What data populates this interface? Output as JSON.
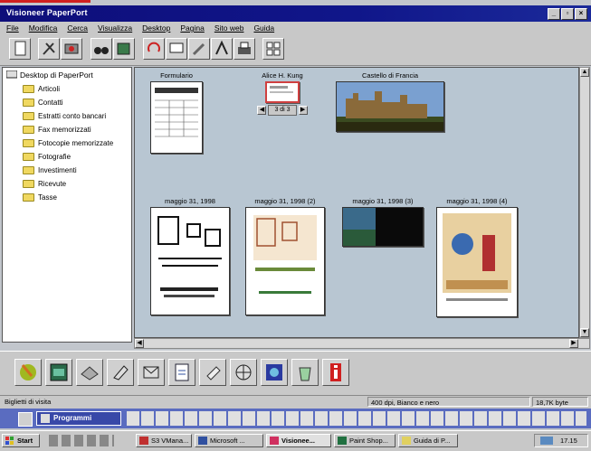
{
  "window": {
    "title": "Visioneer PaperPort"
  },
  "menu": [
    "File",
    "Modifica",
    "Cerca",
    "Visualizza",
    "Desktop",
    "Pagina",
    "Sito web",
    "Guida"
  ],
  "sidebar": {
    "root": "Desktop di PaperPort",
    "folders": [
      "Articoli",
      "Contatti",
      "Estratti conto bancari",
      "Fax memorizzati",
      "Fotocopie memorizzate",
      "Fotografie",
      "Investimenti",
      "Ricevute",
      "Tasse"
    ]
  },
  "items": [
    {
      "caption": "Formulario"
    },
    {
      "caption": "Alice H. Kung",
      "pager": "3 di 3"
    },
    {
      "caption": "Castello di Francia"
    },
    {
      "caption": "maggio 31, 1998"
    },
    {
      "caption": "maggio 31, 1998 (2)"
    },
    {
      "caption": "maggio 31, 1998 (3)"
    },
    {
      "caption": "maggio 31, 1998 (4)"
    }
  ],
  "status": {
    "left": "Biglietti di visita",
    "mid": "400 dpi, Bianco e nero",
    "right": "18,7K byte"
  },
  "officebar": {
    "label": "Programmi"
  },
  "taskbar": {
    "start": "Start",
    "tasks": [
      "S3 VMana...",
      "Microsoft ...",
      "Visionee...",
      "Paint Shop...",
      "Guida di P..."
    ],
    "clock": "17.15"
  },
  "colors": {
    "title": "#10168a",
    "workspace": "#b8c6d2"
  }
}
